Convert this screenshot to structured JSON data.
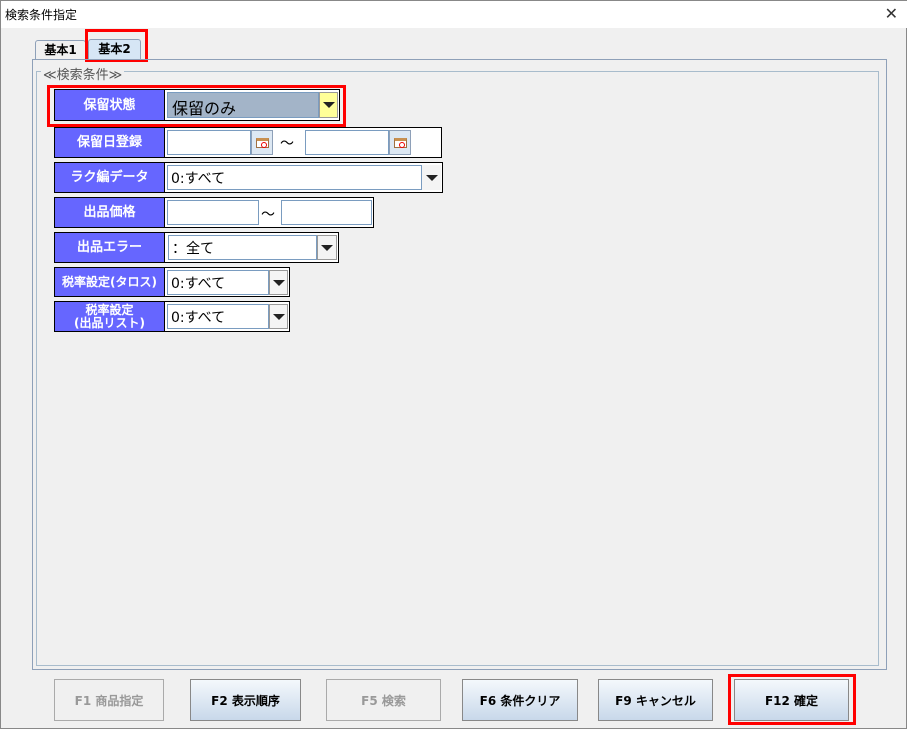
{
  "window": {
    "title": "検索条件指定",
    "close": "✕"
  },
  "tabs": [
    {
      "label": "基本1",
      "selected": false
    },
    {
      "label": "基本2",
      "selected": true
    }
  ],
  "group": {
    "label": "≪検索条件≫"
  },
  "fields": {
    "hold_status": {
      "label": "保留状態",
      "value": "保留のみ"
    },
    "hold_date": {
      "label": "保留日登録",
      "from": "",
      "to": "",
      "separator": "～"
    },
    "rakuhen": {
      "label": "ラク編データ",
      "value": "0:すべて"
    },
    "price": {
      "label": "出品価格",
      "from": "",
      "to": "",
      "separator": "～"
    },
    "listing_error": {
      "label": "出品エラー",
      "value": "：全て"
    },
    "tax_tacross": {
      "label": "税率設定(タロス)",
      "value": "0:すべて"
    },
    "tax_list": {
      "label": "税率設定",
      "label2": "(出品リスト)",
      "value": "0:すべて"
    }
  },
  "buttons": [
    {
      "label": "F1 商品指定",
      "enabled": false
    },
    {
      "label": "F2 表示順序",
      "enabled": true
    },
    {
      "label": "F5 検索",
      "enabled": false
    },
    {
      "label": "F6 条件クリア",
      "enabled": true
    },
    {
      "label": "F9 キャンセル",
      "enabled": true
    },
    {
      "label": "F12 確定",
      "enabled": true
    }
  ],
  "colors": {
    "label_bg": "#6666ff",
    "highlight": "#ff0000",
    "selected_combo": "#a3b4c8",
    "arrow_focus": "#ffff99"
  }
}
